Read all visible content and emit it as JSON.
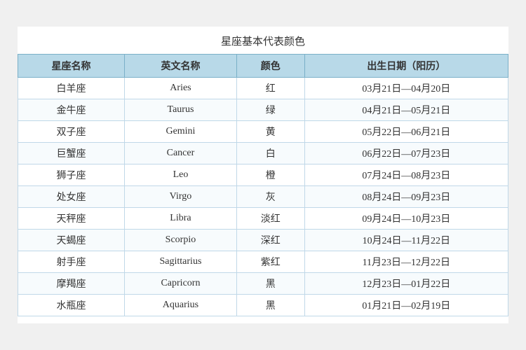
{
  "title": "星座基本代表颜色",
  "columns": [
    "星座名称",
    "英文名称",
    "颜色",
    "出生日期（阳历）"
  ],
  "rows": [
    {
      "name": "白羊座",
      "english": "Aries",
      "color": "红",
      "dates": "03月21日—04月20日"
    },
    {
      "name": "金牛座",
      "english": "Taurus",
      "color": "绿",
      "dates": "04月21日—05月21日"
    },
    {
      "name": "双子座",
      "english": "Gemini",
      "color": "黄",
      "dates": "05月22日—06月21日"
    },
    {
      "name": "巨蟹座",
      "english": "Cancer",
      "color": "白",
      "dates": "06月22日—07月23日"
    },
    {
      "name": "狮子座",
      "english": "Leo",
      "color": "橙",
      "dates": "07月24日—08月23日"
    },
    {
      "name": "处女座",
      "english": "Virgo",
      "color": "灰",
      "dates": "08月24日—09月23日"
    },
    {
      "name": "天秤座",
      "english": "Libra",
      "color": "淡红",
      "dates": "09月24日—10月23日"
    },
    {
      "name": "天蝎座",
      "english": "Scorpio",
      "color": "深红",
      "dates": "10月24日—11月22日"
    },
    {
      "name": "射手座",
      "english": "Sagittarius",
      "color": "紫红",
      "dates": "11月23日—12月22日"
    },
    {
      "name": "摩羯座",
      "english": "Capricorn",
      "color": "黑",
      "dates": "12月23日—01月22日"
    },
    {
      "name": "水瓶座",
      "english": "Aquarius",
      "color": "黑",
      "dates": "01月21日—02月19日"
    }
  ]
}
